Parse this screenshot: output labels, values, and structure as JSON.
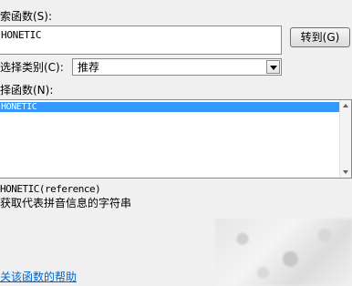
{
  "search": {
    "label": "索函数(S):",
    "value": "HONETIC"
  },
  "go_button": {
    "label": "转到(G)"
  },
  "category": {
    "label": "选择类别(C):",
    "selected": "推荐"
  },
  "function_list": {
    "label": "择函数(N):",
    "items": [
      "HONETIC"
    ]
  },
  "signature": "HONETIC(reference)",
  "description": "获取代表拼音信息的字符串",
  "help_link": "关该函数的帮助",
  "colors": {
    "selection": "#3399ff",
    "link": "#0066cc"
  }
}
